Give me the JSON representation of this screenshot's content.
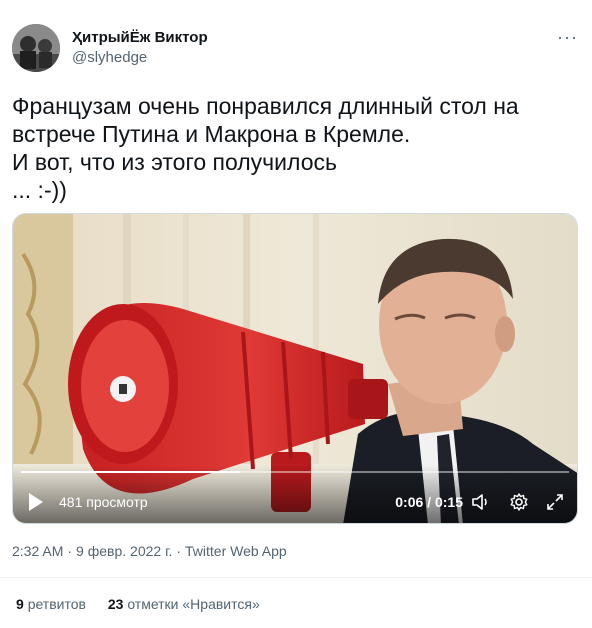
{
  "author": {
    "display_name": "ҲитрыйЁж Виктор",
    "handle": "@slyhedge",
    "avatar_icon": "avatar-photo"
  },
  "more_icon": "ellipsis-icon",
  "more_label": "···",
  "tweet": {
    "text": "Французам очень понравился длинный стол на\nвстрече Путина и Макрона в Кремле.\nИ вот, что из этого получилось\n... :-))"
  },
  "video": {
    "views_label": "481 просмотр",
    "current_time": "0:06",
    "duration": "0:15",
    "time_separator": " / ",
    "progress": 0.4,
    "controls": [
      "play-icon",
      "volume-icon",
      "settings-gear-icon",
      "fullscreen-icon"
    ]
  },
  "meta": {
    "time": "2:32 AM",
    "date": "9 февр. 2022 г.",
    "source": "Twitter Web App",
    "separator": "·"
  },
  "stats": {
    "retweets_count": "9",
    "retweets_label": "ретвитов",
    "likes_count": "23",
    "likes_label": "отметки «Нравится»"
  },
  "colors": {
    "text_primary": "#0f1419",
    "text_secondary": "#536471",
    "megaphone_red": "#d32a2a"
  }
}
